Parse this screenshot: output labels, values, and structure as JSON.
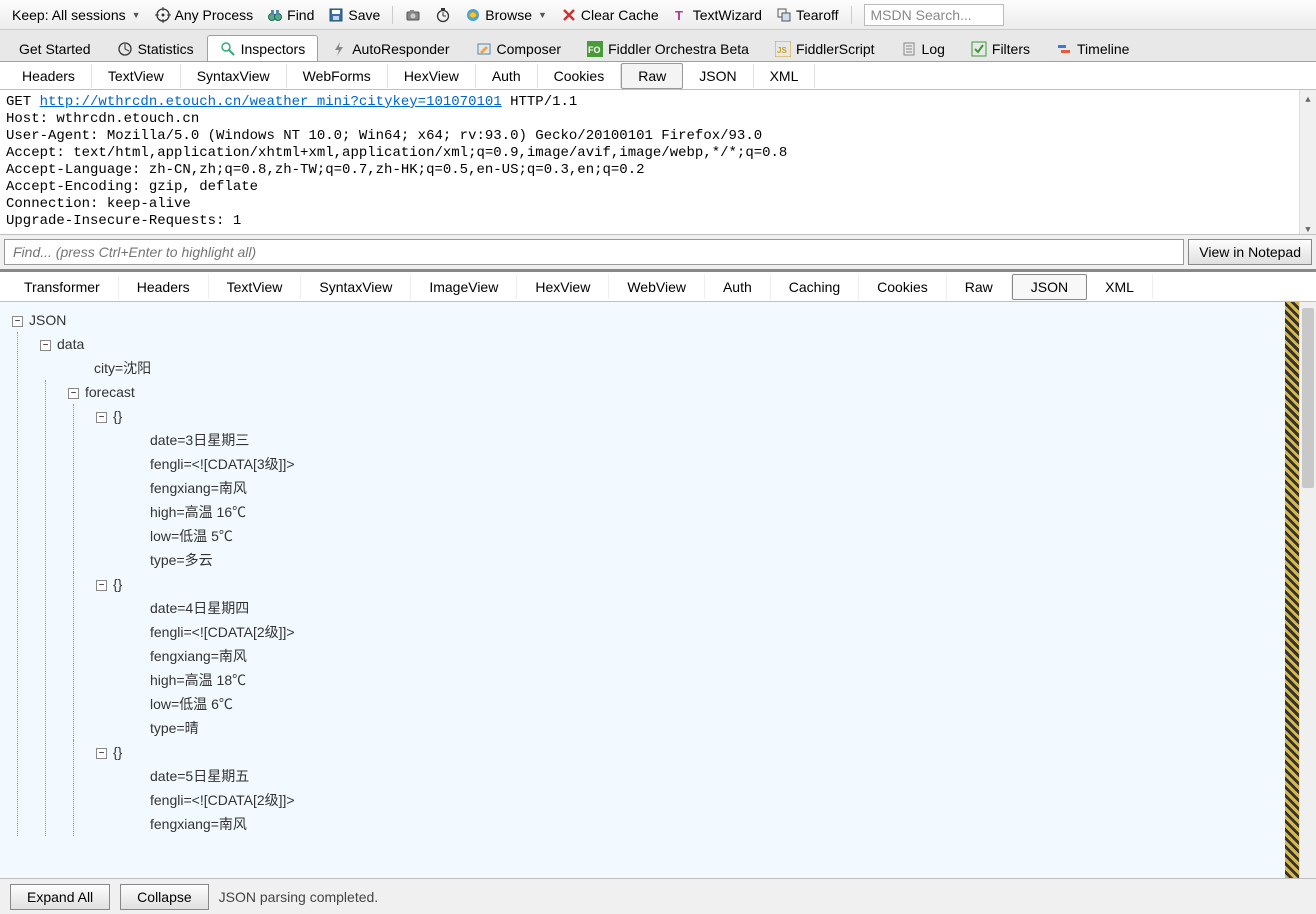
{
  "toolbar": {
    "keep_label": "Keep: All sessions",
    "any_process": "Any Process",
    "find": "Find",
    "save": "Save",
    "browse": "Browse",
    "clear_cache": "Clear Cache",
    "text_wizard": "TextWizard",
    "tearoff": "Tearoff",
    "msdn_placeholder": "MSDN Search..."
  },
  "main_tabs": {
    "get_started": "Get Started",
    "statistics": "Statistics",
    "inspectors": "Inspectors",
    "autoresponder": "AutoResponder",
    "composer": "Composer",
    "orchestra": "Fiddler Orchestra Beta",
    "fiddlerscript": "FiddlerScript",
    "log": "Log",
    "filters": "Filters",
    "timeline": "Timeline"
  },
  "req_tabs": {
    "headers": "Headers",
    "textview": "TextView",
    "syntaxview": "SyntaxView",
    "webforms": "WebForms",
    "hexview": "HexView",
    "auth": "Auth",
    "cookies": "Cookies",
    "raw": "Raw",
    "json": "JSON",
    "xml": "XML"
  },
  "raw_request": {
    "method": "GET ",
    "url": "http://wthrcdn.etouch.cn/weather_mini?citykey=101070101",
    "http": " HTTP/1.1",
    "lines": [
      "Host: wthrcdn.etouch.cn",
      "User-Agent: Mozilla/5.0 (Windows NT 10.0; Win64; x64; rv:93.0) Gecko/20100101 Firefox/93.0",
      "Accept: text/html,application/xhtml+xml,application/xml;q=0.9,image/avif,image/webp,*/*;q=0.8",
      "Accept-Language: zh-CN,zh;q=0.8,zh-TW;q=0.7,zh-HK;q=0.5,en-US;q=0.3,en;q=0.2",
      "Accept-Encoding: gzip, deflate",
      "Connection: keep-alive",
      "Upgrade-Insecure-Requests: 1"
    ]
  },
  "find_placeholder": "Find... (press Ctrl+Enter to highlight all)",
  "view_notepad": "View in Notepad",
  "resp_tabs": {
    "transformer": "Transformer",
    "headers": "Headers",
    "textview": "TextView",
    "syntaxview": "SyntaxView",
    "imageview": "ImageView",
    "hexview": "HexView",
    "webview": "WebView",
    "auth": "Auth",
    "caching": "Caching",
    "cookies": "Cookies",
    "raw": "Raw",
    "json": "JSON",
    "xml": "XML"
  },
  "tree": {
    "root": "JSON",
    "data": "data",
    "city": "city=沈阳",
    "forecast": "forecast",
    "obj": "{}",
    "f1": {
      "date": "date=3日星期三",
      "fengli": "fengli=<![CDATA[3级]]>",
      "fengxiang": "fengxiang=南风",
      "high": "high=高温 16℃",
      "low": "low=低温 5℃",
      "type": "type=多云"
    },
    "f2": {
      "date": "date=4日星期四",
      "fengli": "fengli=<![CDATA[2级]]>",
      "fengxiang": "fengxiang=南风",
      "high": "high=高温 18℃",
      "low": "low=低温 6℃",
      "type": "type=晴"
    },
    "f3": {
      "date": "date=5日星期五",
      "fengli": "fengli=<![CDATA[2级]]>",
      "fengxiang": "fengxiang=南风"
    }
  },
  "footer": {
    "expand": "Expand All",
    "collapse": "Collapse",
    "status": "JSON parsing completed."
  }
}
